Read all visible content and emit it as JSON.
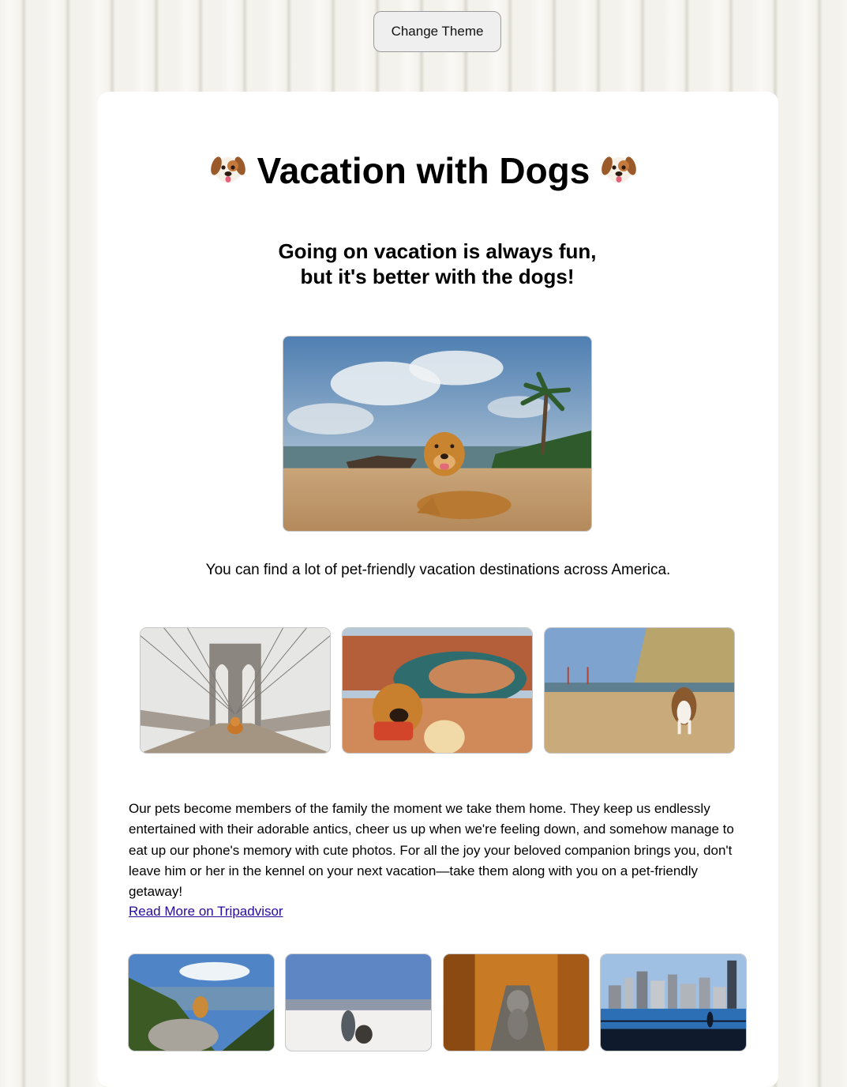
{
  "toolbar": {
    "change_theme_label": "Change Theme"
  },
  "page": {
    "title": "Vacation with Dogs",
    "title_icon": "dog-face-icon",
    "subtitle_line1": "Going on vacation is always fun,",
    "subtitle_line2": "but it's better with the dogs!",
    "intro": "You can find a lot of pet-friendly vacation destinations across America.",
    "body": "Our pets become members of the family the moment we take them home. They keep us endlessly entertained with their adorable antics, cheer us up when we're feeling down, and somehow manage to eat up our phone's memory with cute photos. For all the joy your beloved companion brings you, don't leave him or her in the kennel on your next vacation—take them along with you on a pet-friendly getaway!",
    "read_more": "Read More on Tripadvisor"
  },
  "colors": {
    "background": "#f4f2ec",
    "card": "#ffffff",
    "link": "#2a0a9a",
    "button_bg": "#efefef"
  }
}
